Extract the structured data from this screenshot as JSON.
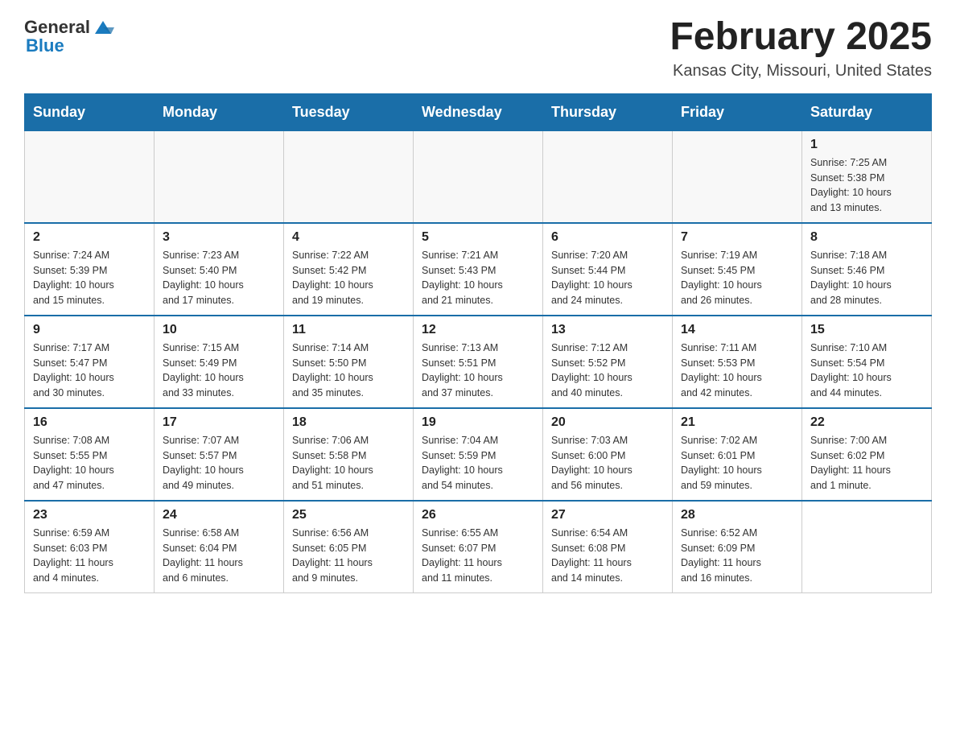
{
  "header": {
    "logo_general": "General",
    "logo_blue": "Blue",
    "month_title": "February 2025",
    "location": "Kansas City, Missouri, United States"
  },
  "days_of_week": [
    "Sunday",
    "Monday",
    "Tuesday",
    "Wednesday",
    "Thursday",
    "Friday",
    "Saturday"
  ],
  "weeks": [
    [
      {
        "day": "",
        "info": ""
      },
      {
        "day": "",
        "info": ""
      },
      {
        "day": "",
        "info": ""
      },
      {
        "day": "",
        "info": ""
      },
      {
        "day": "",
        "info": ""
      },
      {
        "day": "",
        "info": ""
      },
      {
        "day": "1",
        "info": "Sunrise: 7:25 AM\nSunset: 5:38 PM\nDaylight: 10 hours\nand 13 minutes."
      }
    ],
    [
      {
        "day": "2",
        "info": "Sunrise: 7:24 AM\nSunset: 5:39 PM\nDaylight: 10 hours\nand 15 minutes."
      },
      {
        "day": "3",
        "info": "Sunrise: 7:23 AM\nSunset: 5:40 PM\nDaylight: 10 hours\nand 17 minutes."
      },
      {
        "day": "4",
        "info": "Sunrise: 7:22 AM\nSunset: 5:42 PM\nDaylight: 10 hours\nand 19 minutes."
      },
      {
        "day": "5",
        "info": "Sunrise: 7:21 AM\nSunset: 5:43 PM\nDaylight: 10 hours\nand 21 minutes."
      },
      {
        "day": "6",
        "info": "Sunrise: 7:20 AM\nSunset: 5:44 PM\nDaylight: 10 hours\nand 24 minutes."
      },
      {
        "day": "7",
        "info": "Sunrise: 7:19 AM\nSunset: 5:45 PM\nDaylight: 10 hours\nand 26 minutes."
      },
      {
        "day": "8",
        "info": "Sunrise: 7:18 AM\nSunset: 5:46 PM\nDaylight: 10 hours\nand 28 minutes."
      }
    ],
    [
      {
        "day": "9",
        "info": "Sunrise: 7:17 AM\nSunset: 5:47 PM\nDaylight: 10 hours\nand 30 minutes."
      },
      {
        "day": "10",
        "info": "Sunrise: 7:15 AM\nSunset: 5:49 PM\nDaylight: 10 hours\nand 33 minutes."
      },
      {
        "day": "11",
        "info": "Sunrise: 7:14 AM\nSunset: 5:50 PM\nDaylight: 10 hours\nand 35 minutes."
      },
      {
        "day": "12",
        "info": "Sunrise: 7:13 AM\nSunset: 5:51 PM\nDaylight: 10 hours\nand 37 minutes."
      },
      {
        "day": "13",
        "info": "Sunrise: 7:12 AM\nSunset: 5:52 PM\nDaylight: 10 hours\nand 40 minutes."
      },
      {
        "day": "14",
        "info": "Sunrise: 7:11 AM\nSunset: 5:53 PM\nDaylight: 10 hours\nand 42 minutes."
      },
      {
        "day": "15",
        "info": "Sunrise: 7:10 AM\nSunset: 5:54 PM\nDaylight: 10 hours\nand 44 minutes."
      }
    ],
    [
      {
        "day": "16",
        "info": "Sunrise: 7:08 AM\nSunset: 5:55 PM\nDaylight: 10 hours\nand 47 minutes."
      },
      {
        "day": "17",
        "info": "Sunrise: 7:07 AM\nSunset: 5:57 PM\nDaylight: 10 hours\nand 49 minutes."
      },
      {
        "day": "18",
        "info": "Sunrise: 7:06 AM\nSunset: 5:58 PM\nDaylight: 10 hours\nand 51 minutes."
      },
      {
        "day": "19",
        "info": "Sunrise: 7:04 AM\nSunset: 5:59 PM\nDaylight: 10 hours\nand 54 minutes."
      },
      {
        "day": "20",
        "info": "Sunrise: 7:03 AM\nSunset: 6:00 PM\nDaylight: 10 hours\nand 56 minutes."
      },
      {
        "day": "21",
        "info": "Sunrise: 7:02 AM\nSunset: 6:01 PM\nDaylight: 10 hours\nand 59 minutes."
      },
      {
        "day": "22",
        "info": "Sunrise: 7:00 AM\nSunset: 6:02 PM\nDaylight: 11 hours\nand 1 minute."
      }
    ],
    [
      {
        "day": "23",
        "info": "Sunrise: 6:59 AM\nSunset: 6:03 PM\nDaylight: 11 hours\nand 4 minutes."
      },
      {
        "day": "24",
        "info": "Sunrise: 6:58 AM\nSunset: 6:04 PM\nDaylight: 11 hours\nand 6 minutes."
      },
      {
        "day": "25",
        "info": "Sunrise: 6:56 AM\nSunset: 6:05 PM\nDaylight: 11 hours\nand 9 minutes."
      },
      {
        "day": "26",
        "info": "Sunrise: 6:55 AM\nSunset: 6:07 PM\nDaylight: 11 hours\nand 11 minutes."
      },
      {
        "day": "27",
        "info": "Sunrise: 6:54 AM\nSunset: 6:08 PM\nDaylight: 11 hours\nand 14 minutes."
      },
      {
        "day": "28",
        "info": "Sunrise: 6:52 AM\nSunset: 6:09 PM\nDaylight: 11 hours\nand 16 minutes."
      },
      {
        "day": "",
        "info": ""
      }
    ]
  ]
}
